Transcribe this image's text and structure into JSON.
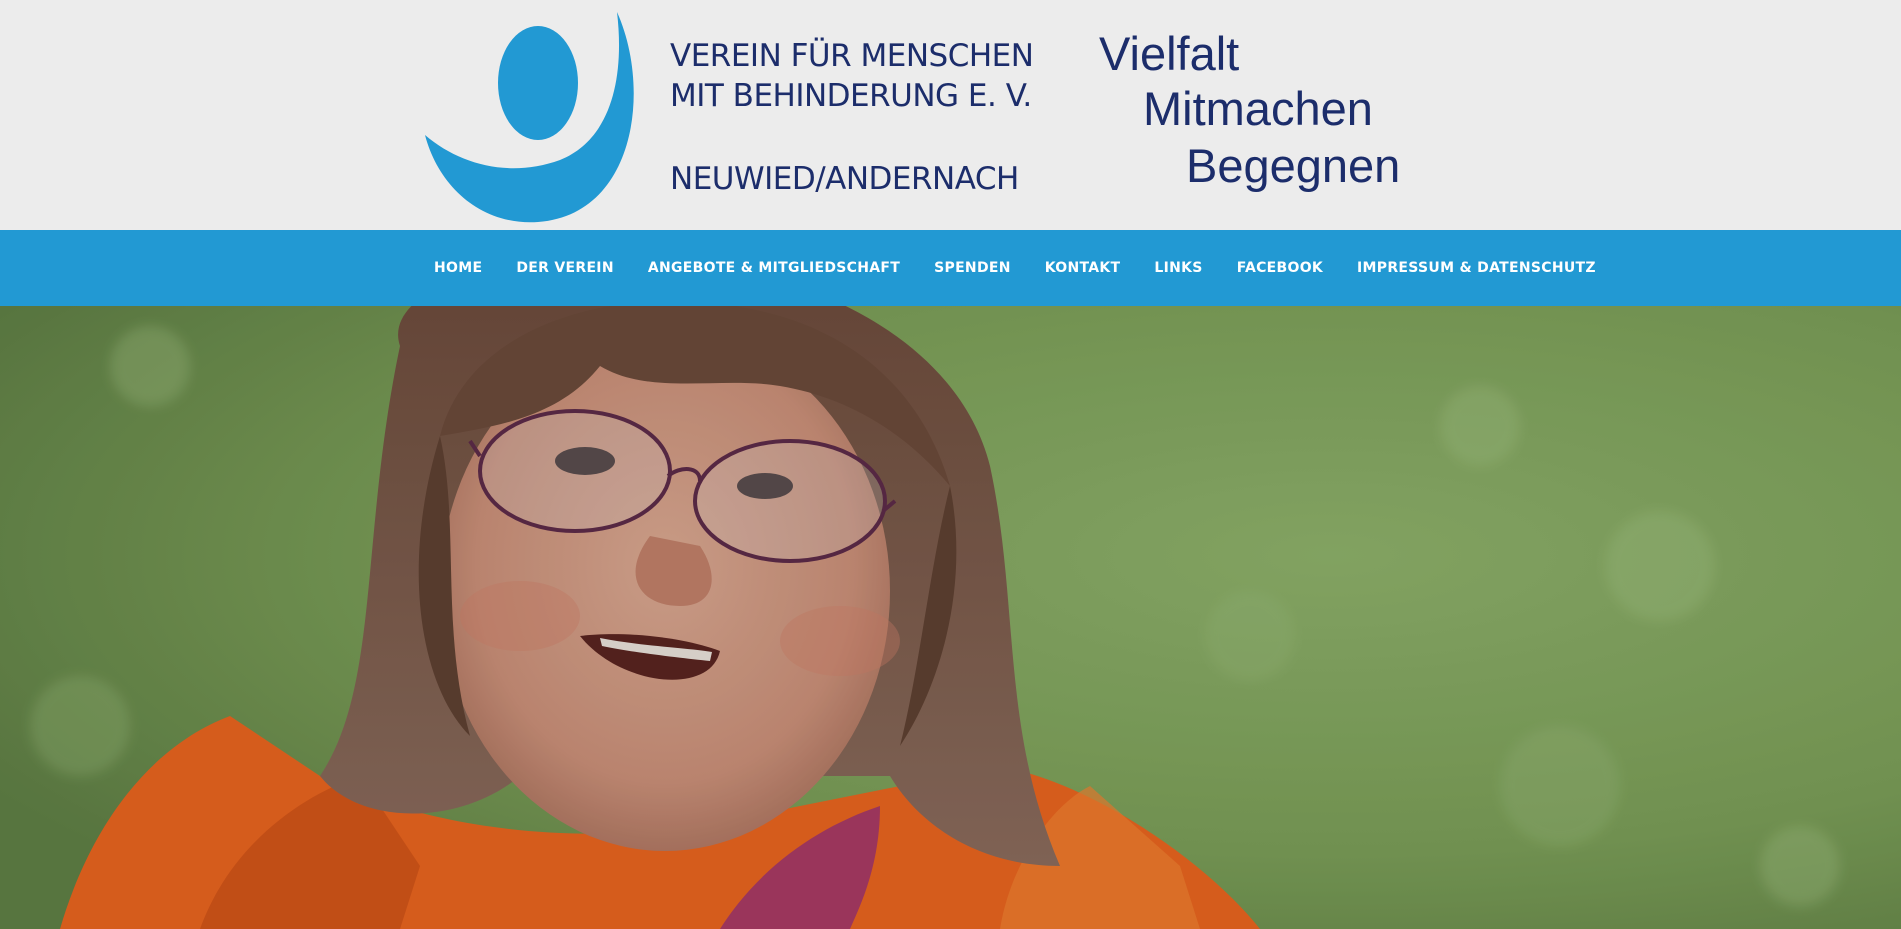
{
  "header": {
    "org_line_1": "VEREIN FÜR MENSCHEN",
    "org_line_2": "MIT BEHINDERUNG E. V.",
    "org_city": "NEUWIED/ANDERNACH",
    "slogan": [
      "Vielfalt",
      "Mitmachen",
      "Begegnen"
    ],
    "logo_icon": "person-arc-logo",
    "brand_blue": "#2299d3",
    "text_navy": "#1c2d6b"
  },
  "nav": {
    "items": [
      {
        "label": "HOME"
      },
      {
        "label": "DER VEREIN"
      },
      {
        "label": "ANGEBOTE & MITGLIEDSCHAFT"
      },
      {
        "label": "SPENDEN"
      },
      {
        "label": "KONTAKT"
      },
      {
        "label": "LINKS"
      },
      {
        "label": "FACEBOOK"
      },
      {
        "label": "IMPRESSUM & DATENSCHUTZ"
      }
    ]
  },
  "hero": {
    "image": "photo of smiling girl with glasses in orange jacket on green meadow"
  }
}
